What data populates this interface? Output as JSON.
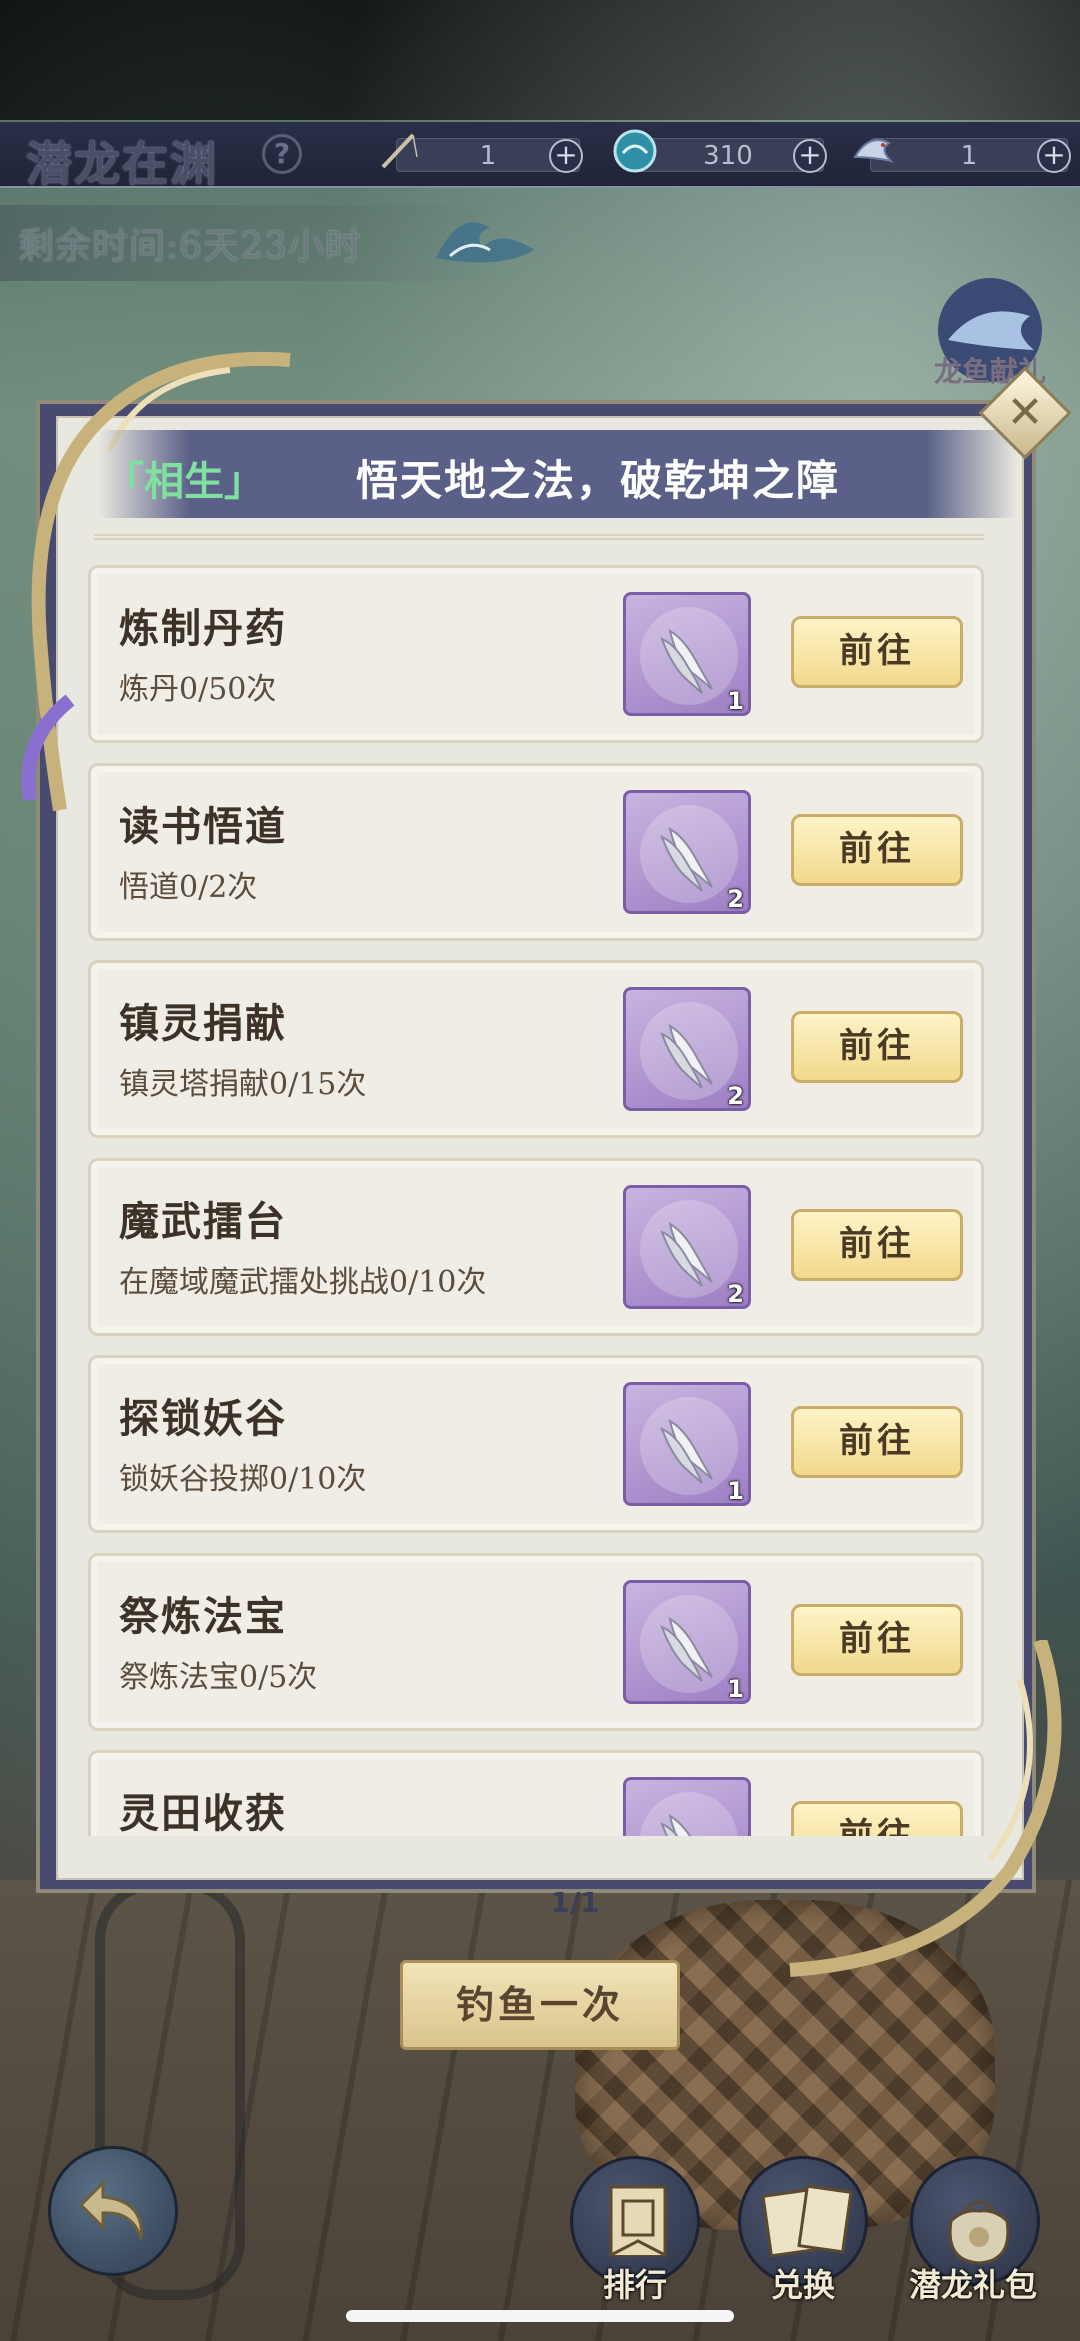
{
  "topbar": {
    "title": "潜龙在渊",
    "help_glyph": "?",
    "resources": [
      {
        "icon": "fishing-rod-icon",
        "value": "1"
      },
      {
        "icon": "bait-orb-icon",
        "value": "310"
      },
      {
        "icon": "dragon-fish-icon",
        "value": "1"
      }
    ],
    "plus_glyph": "+"
  },
  "timer": {
    "text": "剩余时间:6天23小时"
  },
  "gift": {
    "label": "龙鱼献礼"
  },
  "modal": {
    "header_tag": "「相生」",
    "header_text": "悟天地之法，破乾坤之障",
    "close_glyph": "✕",
    "tasks": [
      {
        "name": "炼制丹药",
        "desc": "炼丹0/50次",
        "reward_count": "1",
        "button": "前往"
      },
      {
        "name": "读书悟道",
        "desc": "悟道0/2次",
        "reward_count": "2",
        "button": "前往"
      },
      {
        "name": "镇灵捐献",
        "desc": "镇灵塔捐献0/15次",
        "reward_count": "2",
        "button": "前往"
      },
      {
        "name": "魔武擂台",
        "desc": "在魔域魔武擂处挑战0/10次",
        "reward_count": "2",
        "button": "前往"
      },
      {
        "name": "探锁妖谷",
        "desc": "锁妖谷投掷0/10次",
        "reward_count": "1",
        "button": "前往"
      },
      {
        "name": "祭炼法宝",
        "desc": "祭炼法宝0/5次",
        "reward_count": "1",
        "button": "前往"
      },
      {
        "name": "灵田收获",
        "desc": "",
        "reward_count": "",
        "button": "前往"
      }
    ]
  },
  "page_indicator": "1/1",
  "fish_button": "钓鱼一次",
  "bottom_nav": [
    {
      "label": "排行",
      "icon": "ranking-banner-icon"
    },
    {
      "label": "兑换",
      "icon": "exchange-cards-icon"
    },
    {
      "label": "潜龙礼包",
      "icon": "gift-pouch-icon"
    }
  ],
  "colors": {
    "modal_frame": "#484a70",
    "panel": "#e9e8e0",
    "header_band": "#5a6087",
    "tag_green": "#7fe0a0",
    "reward_purple": "#9e7fc4",
    "button_gold": "#f1d98c"
  }
}
